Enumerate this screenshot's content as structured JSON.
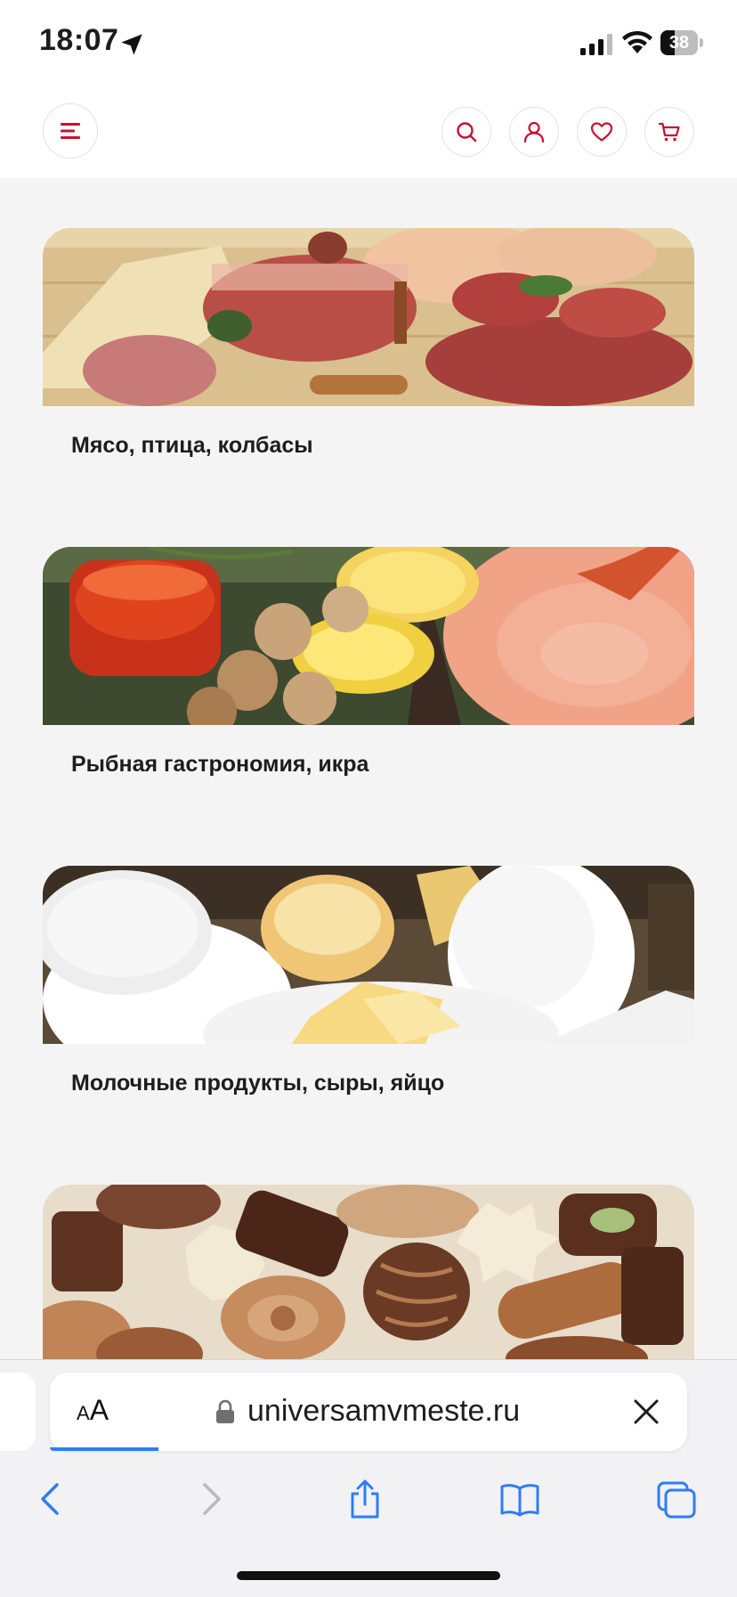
{
  "status_bar": {
    "time": "18:07",
    "battery": "38",
    "battery_level": 0.38
  },
  "header": {
    "icons": [
      "menu-icon",
      "search-icon",
      "user-icon",
      "heart-icon",
      "cart-icon"
    ],
    "accent_color": "#c8102e"
  },
  "categories": [
    {
      "title": "Мясо, птица, колбасы",
      "image": "meat-photo"
    },
    {
      "title": "Рыбная гастрономия, икра",
      "image": "fish-caviar-photo"
    },
    {
      "title": "Молочные продукты, сыры, яйцо",
      "image": "dairy-photo"
    },
    {
      "title": "",
      "image": "chocolates-photo"
    }
  ],
  "safari": {
    "aa_label_small": "A",
    "aa_label_big": "A",
    "url": "universamvmeste.ru",
    "load_progress": 0.17,
    "toolbar_icons": [
      "back-icon",
      "forward-icon",
      "share-icon",
      "bookmarks-icon",
      "tabs-icon"
    ]
  }
}
